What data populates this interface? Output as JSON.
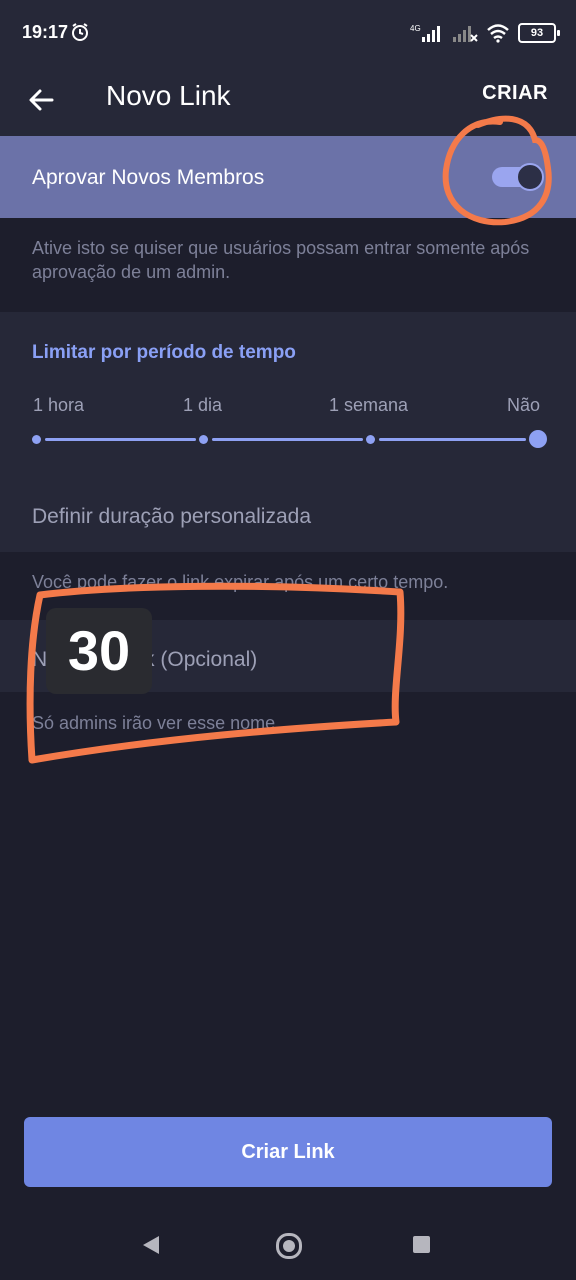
{
  "status_bar": {
    "time": "19:17",
    "network": "4G",
    "battery": "93",
    "icons": [
      "alarm-icon",
      "signal-icon",
      "signal-off-icon",
      "wifi-icon",
      "battery-icon"
    ]
  },
  "app_bar": {
    "title": "Novo Link",
    "action": "CRIAR",
    "back_icon": "arrow-left-icon"
  },
  "approve": {
    "label": "Aprovar Novos Membros",
    "enabled": true,
    "hint": "Ative isto se quiser que usuários possam entrar somente após aprovação de um admin."
  },
  "time_limit": {
    "title": "Limitar por período de tempo",
    "options": [
      "1 hora",
      "1 dia",
      "1 semana",
      "Não"
    ],
    "selected": "Não",
    "custom_label": "Definir duração personalizada",
    "hint": "Você pode fazer o link expirar após um certo tempo."
  },
  "name_field": {
    "placeholder": "Nome do link (Opcional)",
    "hint": "Só admins irão ver esse nome."
  },
  "overlay": {
    "badge_number": "30",
    "annotation_color": "#f47a4a"
  },
  "primary_button": {
    "label": "Criar Link"
  },
  "colors": {
    "background": "#1d1e2c",
    "surface": "#262838",
    "highlight_row": "#6b72a8",
    "accent": "#8ea1f3",
    "button": "#6f86e3"
  }
}
